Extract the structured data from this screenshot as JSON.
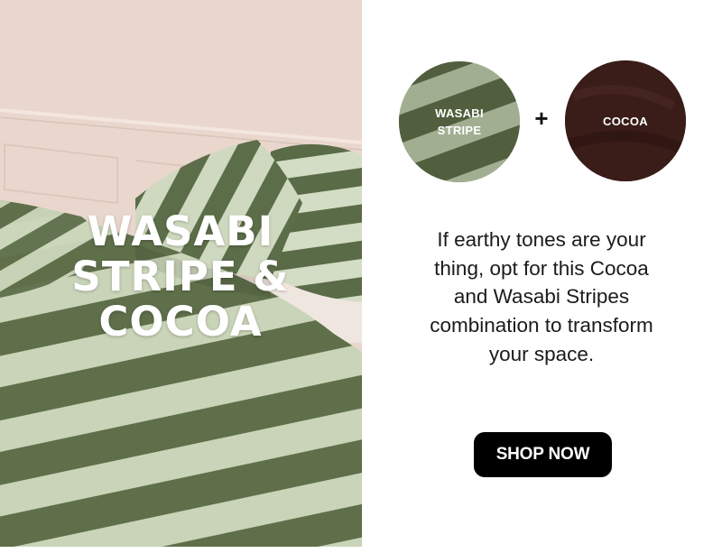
{
  "hero": {
    "title": "WASABI\nSTRIPE &\nCOCOA",
    "image": "striped-bedding-photo"
  },
  "swatches": [
    {
      "label": "WASABI\nSTRIPE",
      "color": "#7a8a66"
    },
    {
      "label": "COCOA",
      "color": "#3a1c18"
    }
  ],
  "combine_symbol": "+",
  "description": "If earthy tones are your thing, opt for this Cocoa and Wasabi Stripes combination to transform your space.",
  "cta": {
    "label": "SHOP NOW"
  },
  "colors": {
    "wasabi_dark": "#5e6f4a",
    "wasabi_light": "#c9d4b8",
    "cocoa": "#3a1c18",
    "wall": "#e8d6cc",
    "button": "#000000"
  }
}
